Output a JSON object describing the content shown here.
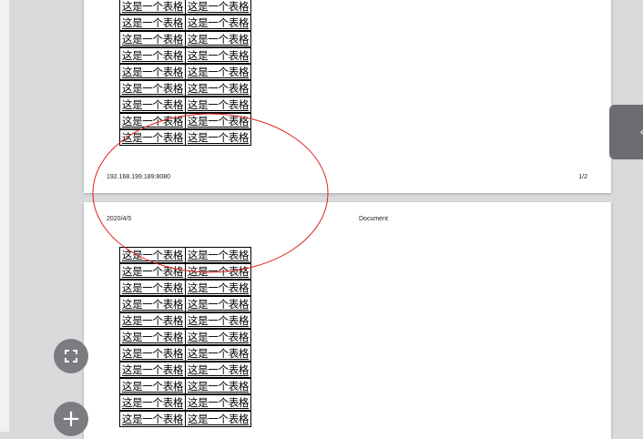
{
  "page1": {
    "table_rows": [
      [
        "这是一个表格",
        "这是一个表格"
      ],
      [
        "这是一个表格",
        "这是一个表格"
      ],
      [
        "这是一个表格",
        "这是一个表格"
      ],
      [
        "这是一个表格",
        "这是一个表格"
      ],
      [
        "这是一个表格",
        "这是一个表格"
      ],
      [
        "这是一个表格",
        "这是一个表格"
      ],
      [
        "这是一个表格",
        "这是一个表格"
      ],
      [
        "这是一个表格",
        "这是一个表格"
      ],
      [
        "这是一个表格",
        "这是一个表格"
      ]
    ],
    "footer_url": "192.168.199.189:8080",
    "footer_page": "1/2"
  },
  "page2": {
    "header_date": "2020/4/5",
    "header_title": "Document",
    "table_rows": [
      [
        "这是一个表格",
        "这是一个表格"
      ],
      [
        "这是一个表格",
        "这是一个表格"
      ],
      [
        "这是一个表格",
        "这是一个表格"
      ],
      [
        "这是一个表格",
        "这是一个表格"
      ],
      [
        "这是一个表格",
        "这是一个表格"
      ],
      [
        "这是一个表格",
        "这是一个表格"
      ],
      [
        "这是一个表格",
        "这是一个表格"
      ],
      [
        "这是一个表格",
        "这是一个表格"
      ],
      [
        "这是一个表格",
        "这是一个表格"
      ],
      [
        "这是一个表格",
        "这是一个表格"
      ],
      [
        "这是一个表格",
        "这是一个表格"
      ]
    ]
  },
  "icons": {
    "fullscreen": "fullscreen-icon",
    "add": "plus-icon",
    "side_tab": "chevron-left-icon"
  },
  "colors": {
    "annotation": "#e02020",
    "fab": "#7b7c80",
    "background": "#d9dadc"
  }
}
